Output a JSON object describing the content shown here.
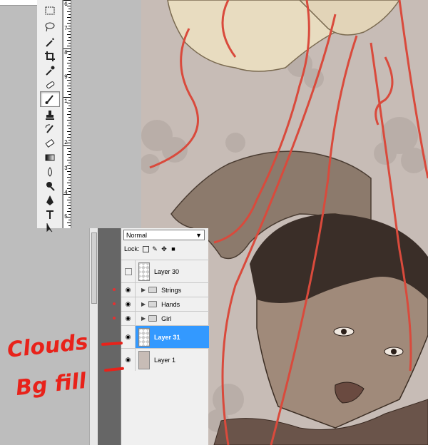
{
  "ruler": {
    "numbers": [
      "6",
      "7",
      "8",
      "9",
      "1",
      "2",
      "3",
      "4",
      "5"
    ]
  },
  "toolbox": {
    "tools": [
      {
        "name": "marquee-tool-icon"
      },
      {
        "name": "lasso-tool-icon"
      },
      {
        "name": "magic-wand-tool-icon"
      },
      {
        "name": "crop-tool-icon"
      },
      {
        "name": "eyedropper-tool-icon"
      },
      {
        "name": "healing-brush-tool-icon"
      },
      {
        "name": "brush-tool-icon",
        "active": true
      },
      {
        "name": "clone-stamp-tool-icon"
      },
      {
        "name": "history-brush-tool-icon"
      },
      {
        "name": "eraser-tool-icon"
      },
      {
        "name": "gradient-tool-icon"
      },
      {
        "name": "blur-tool-icon"
      },
      {
        "name": "dodge-tool-icon"
      },
      {
        "name": "pen-tool-icon"
      },
      {
        "name": "type-tool-icon"
      },
      {
        "name": "path-select-tool-icon"
      }
    ]
  },
  "layers_panel": {
    "blend_mode": "Normal",
    "lock_label": "Lock:",
    "layers": [
      {
        "name": "Layer 30",
        "visible": false
      },
      {
        "name": "Strings",
        "visible": true,
        "group": true
      },
      {
        "name": "Hands",
        "visible": true,
        "group": true
      },
      {
        "name": "Girl",
        "visible": true,
        "group": true
      },
      {
        "name": "Layer 31",
        "visible": true,
        "selected": true
      },
      {
        "name": "Layer 1",
        "visible": true
      }
    ]
  },
  "annotations": {
    "clouds": "Clouds",
    "bg_fill": "Bg fill"
  },
  "colors": {
    "canvas_bg": "#c7bcb6",
    "string_red": "#d94a3c",
    "selection_blue": "#3399ff",
    "annotation_red": "#e8221a"
  }
}
